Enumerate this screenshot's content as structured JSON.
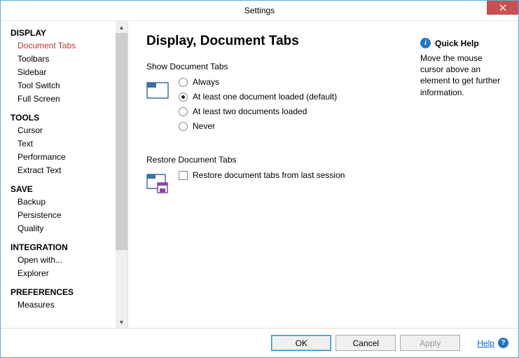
{
  "window": {
    "title": "Settings"
  },
  "sidebar": {
    "sections": [
      {
        "title": "DISPLAY",
        "items": [
          "Document Tabs",
          "Toolbars",
          "Sidebar",
          "Tool Switch",
          "Full Screen"
        ],
        "selectedIndex": 0
      },
      {
        "title": "TOOLS",
        "items": [
          "Cursor",
          "Text",
          "Performance",
          "Extract Text"
        ]
      },
      {
        "title": "SAVE",
        "items": [
          "Backup",
          "Persistence",
          "Quality"
        ]
      },
      {
        "title": "INTEGRATION",
        "items": [
          "Open with...",
          "Explorer"
        ]
      },
      {
        "title": "PREFERENCES",
        "items": [
          "Measures"
        ]
      }
    ]
  },
  "main": {
    "heading": "Display, Document Tabs",
    "group1": {
      "label": "Show Document Tabs",
      "options": [
        "Always",
        "At least one document loaded (default)",
        "At least two documents loaded",
        "Never"
      ],
      "selected": 1
    },
    "group2": {
      "label": "Restore Document Tabs",
      "checkbox": "Restore document tabs from last session",
      "checked": false
    }
  },
  "help": {
    "title": "Quick Help",
    "text": "Move the mouse cursor above an element to get further information."
  },
  "footer": {
    "ok": "OK",
    "cancel": "Cancel",
    "apply": "Apply",
    "help": "Help"
  }
}
